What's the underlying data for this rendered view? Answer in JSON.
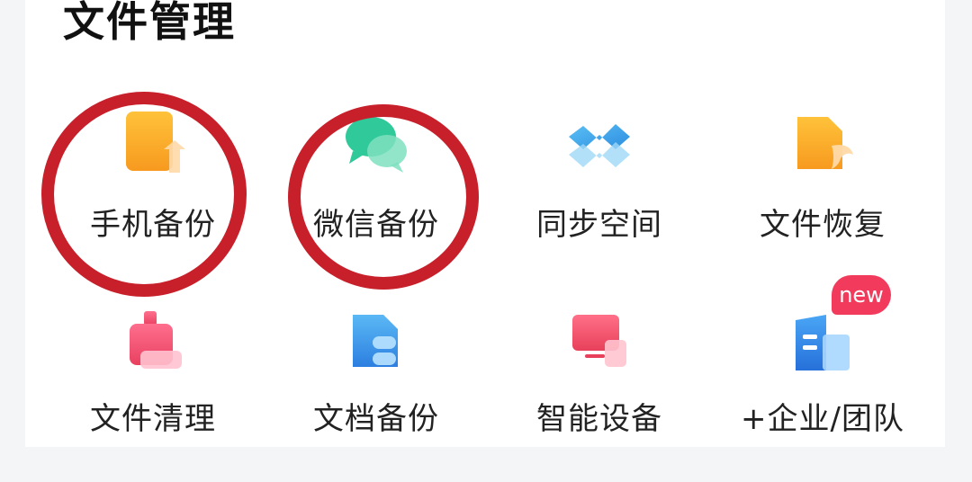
{
  "section": {
    "title": "文件管理"
  },
  "tiles": [
    {
      "label": "手机备份",
      "icon": "phone-backup-icon",
      "color": "#f6a623"
    },
    {
      "label": "微信备份",
      "icon": "wechat-backup-icon",
      "color": "#2fc99a"
    },
    {
      "label": "同步空间",
      "icon": "sync-space-icon",
      "color": "#3aa8e8"
    },
    {
      "label": "文件恢复",
      "icon": "file-recovery-icon",
      "color": "#f7a428"
    },
    {
      "label": "文件清理",
      "icon": "file-clean-icon",
      "color": "#ef4e72"
    },
    {
      "label": "文档备份",
      "icon": "document-backup-icon",
      "color": "#3a9de8"
    },
    {
      "label": "智能设备",
      "icon": "smart-device-icon",
      "color": "#ef4e6a"
    },
    {
      "label": "+企业/团队",
      "icon": "enterprise-team-icon",
      "color": "#2f87e6"
    }
  ],
  "badge": {
    "text": "new",
    "color": "#f23a5c"
  },
  "highlight_color": "#c8202b"
}
